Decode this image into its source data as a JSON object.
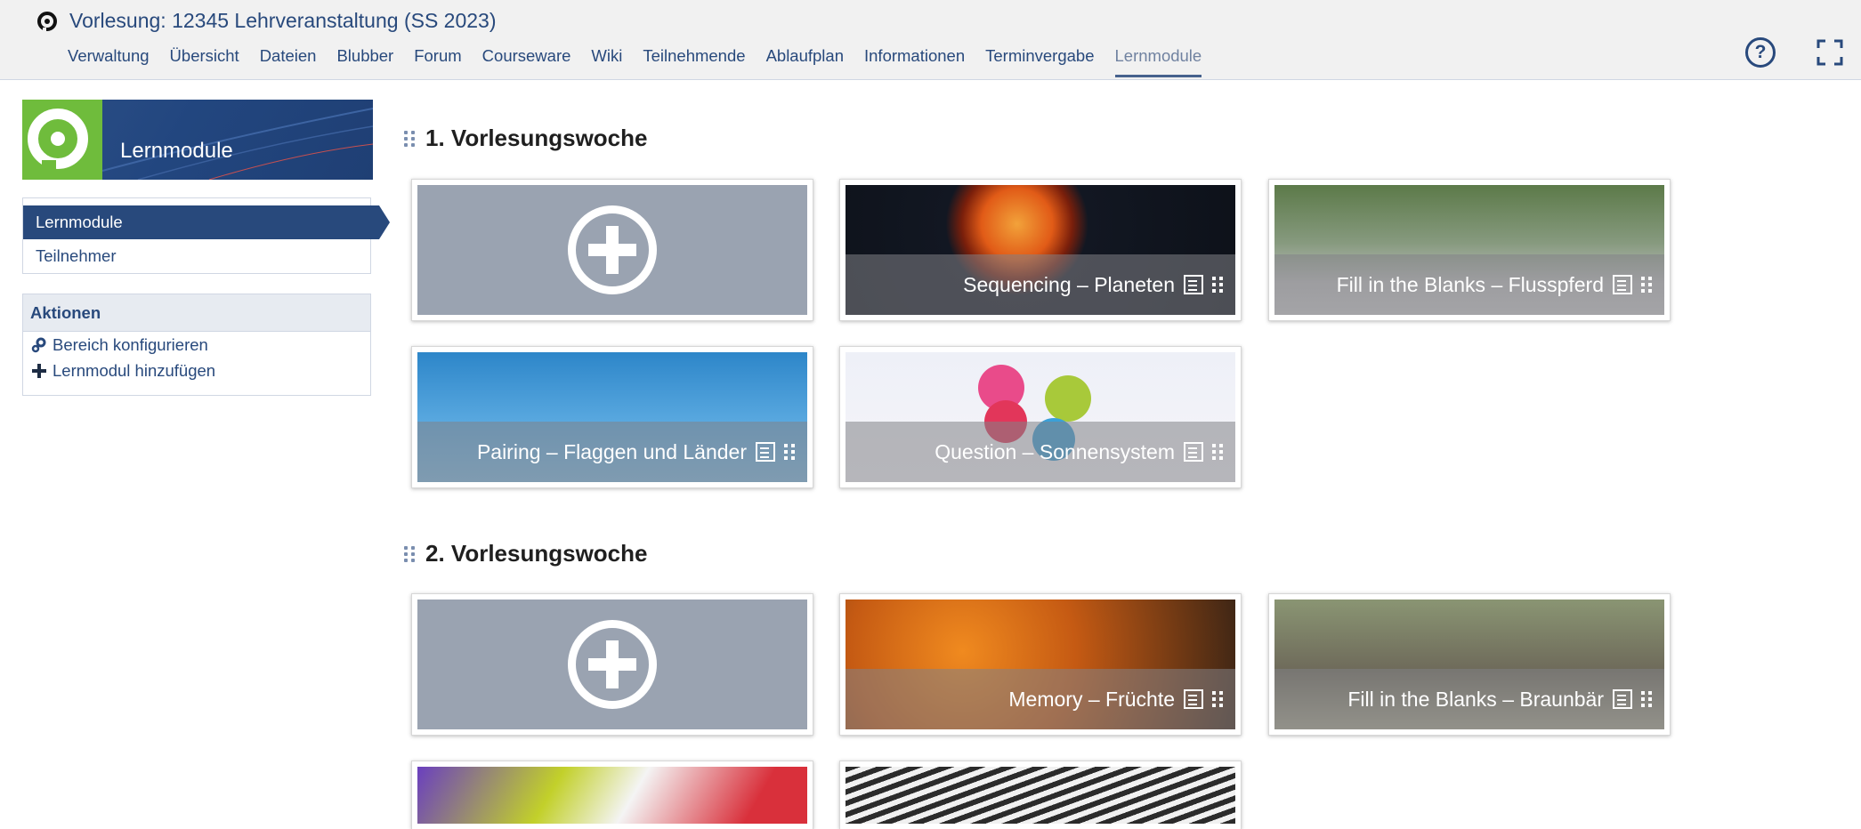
{
  "header": {
    "course_title": "Vorlesung: 12345 Lehrveranstaltung (SS 2023)",
    "nav": [
      "Verwaltung",
      "Übersicht",
      "Dateien",
      "Blubber",
      "Forum",
      "Courseware",
      "Wiki",
      "Teilnehmende",
      "Ablaufplan",
      "Informationen",
      "Terminvergabe",
      "Lernmodule"
    ],
    "active_nav": "Lernmodule",
    "help_icon": "question-circle-icon",
    "fullscreen_icon": "fullscreen-icon"
  },
  "sidebar": {
    "banner_title": "Lernmodule",
    "nav_items": [
      "Lernmodule",
      "Teilnehmer"
    ],
    "actions_title": "Aktionen",
    "actions": [
      {
        "label": "Bereich konfigurieren",
        "icon": "gears-icon"
      },
      {
        "label": "Lernmodul hinzufügen",
        "icon": "plus-icon"
      }
    ]
  },
  "sections": [
    {
      "title": "1. Vorlesungswoche",
      "cards": [
        {
          "label": "",
          "type": "add"
        },
        {
          "label": "Sequencing – Planeten",
          "type": "space"
        },
        {
          "label": "Fill in the Blanks – Flusspferd",
          "type": "hippo"
        },
        {
          "label": "Pairing – Flaggen und Länder",
          "type": "flags"
        },
        {
          "label": "Question – Sonnensystem",
          "type": "question"
        }
      ]
    },
    {
      "title": "2. Vorlesungswoche",
      "cards": [
        {
          "label": "",
          "type": "add"
        },
        {
          "label": "Memory – Früchte",
          "type": "fruit"
        },
        {
          "label": "Fill in the Blanks – Braunbär",
          "type": "bear"
        },
        {
          "label": "",
          "type": "markers"
        },
        {
          "label": "",
          "type": "words"
        }
      ]
    }
  ]
}
